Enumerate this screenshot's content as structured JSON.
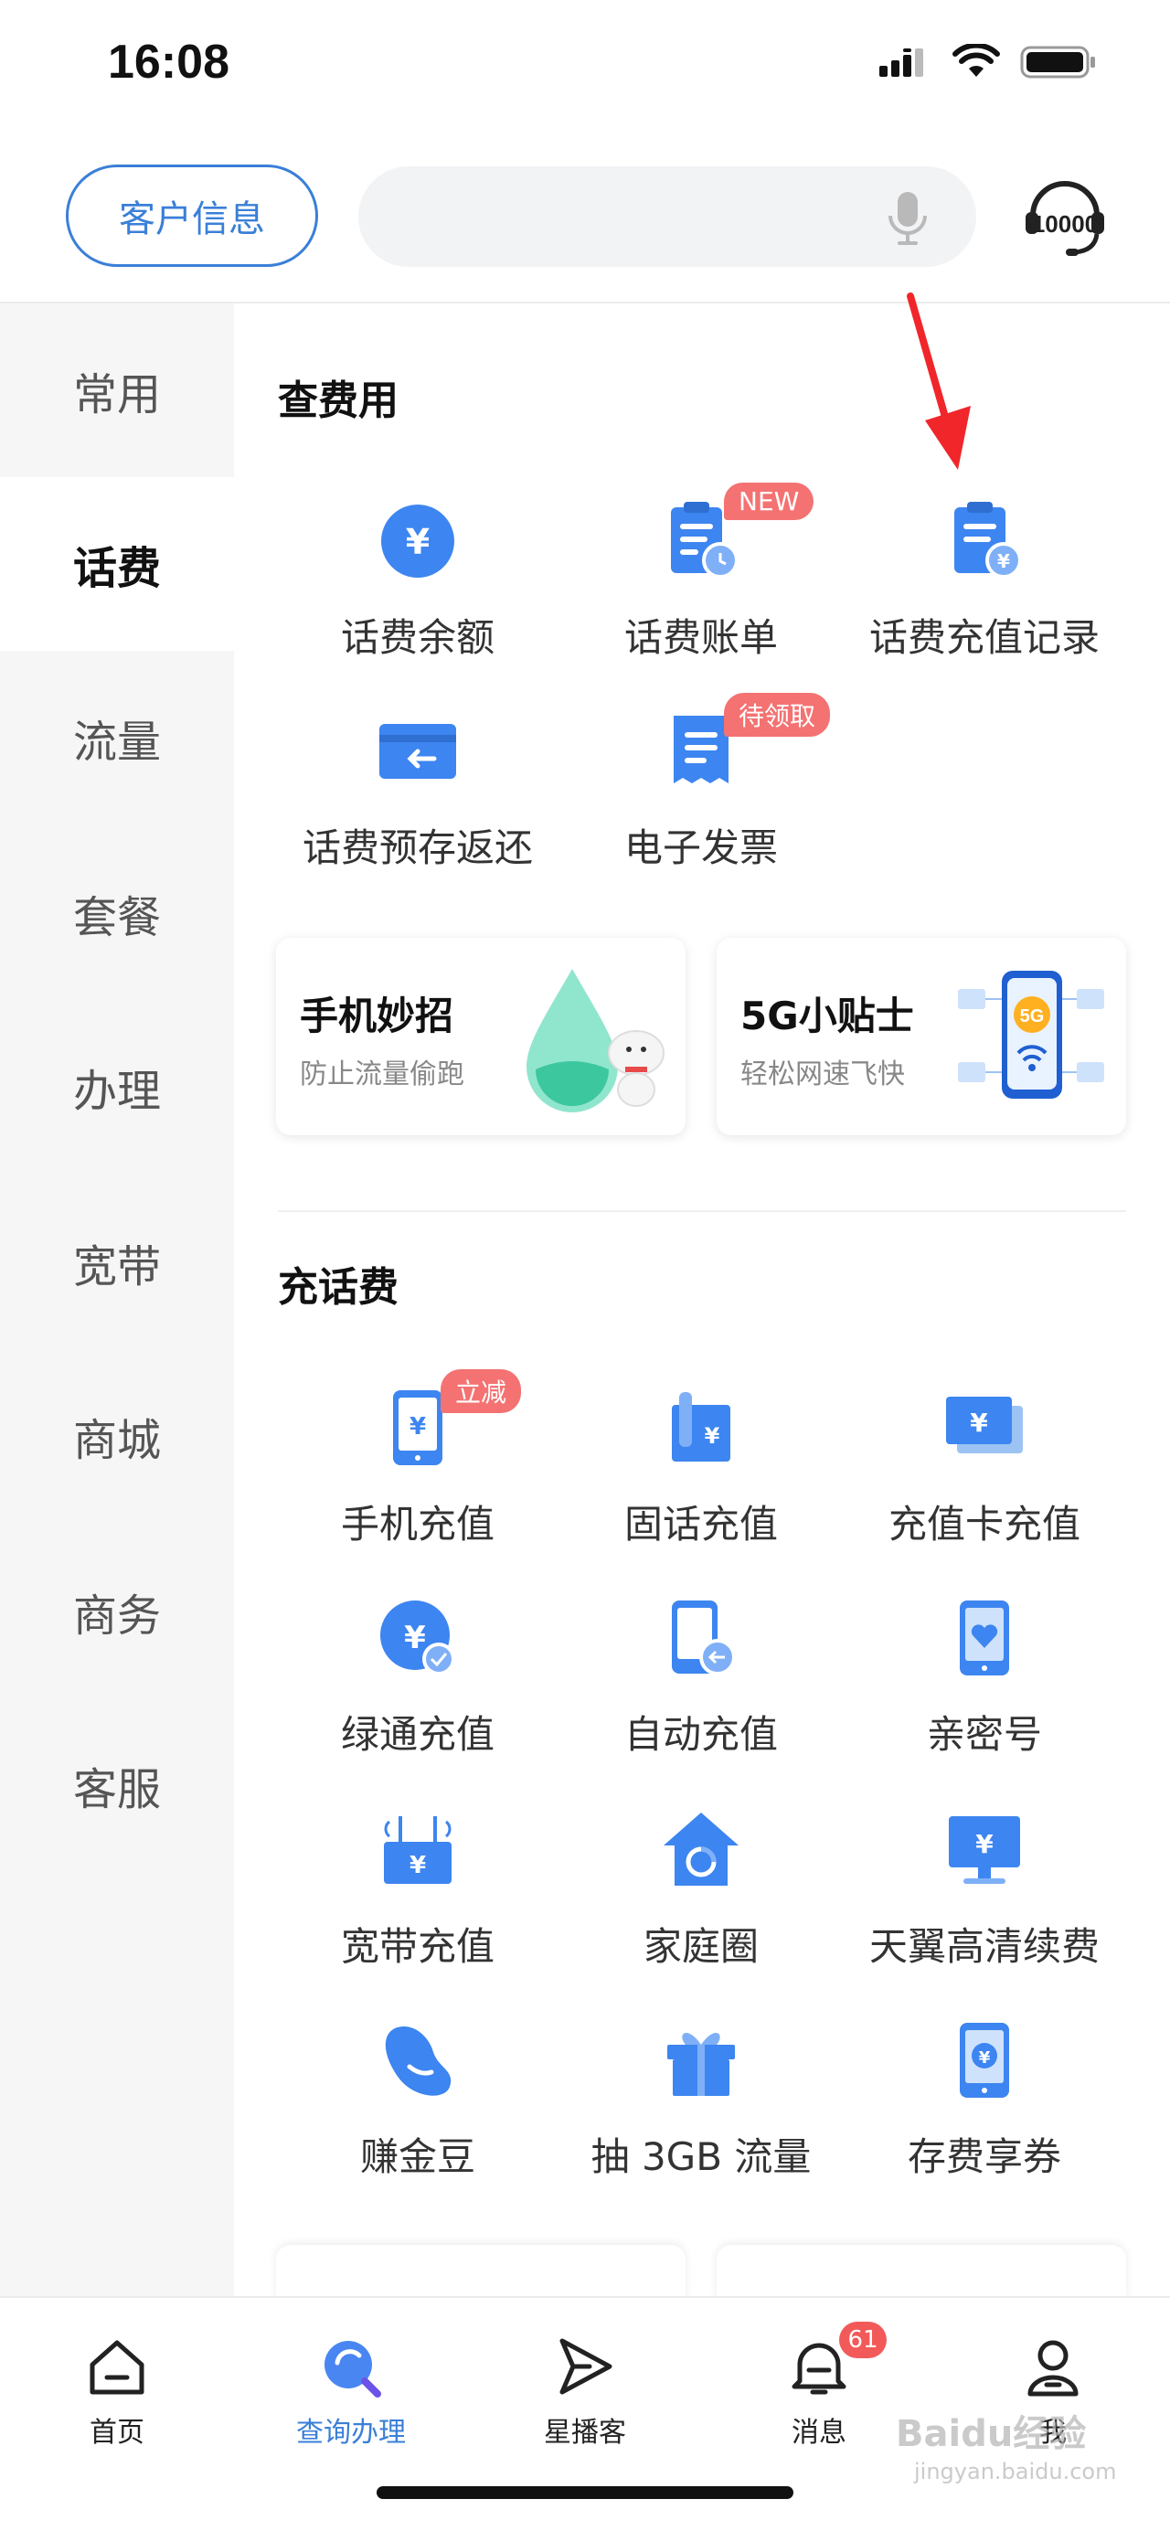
{
  "status_bar": {
    "time": "16:08"
  },
  "header": {
    "customer_info_label": "客户信息",
    "service_icon_text": "10000"
  },
  "sidebar": {
    "items": [
      {
        "label": "常用"
      },
      {
        "label": "话费"
      },
      {
        "label": "流量"
      },
      {
        "label": "套餐"
      },
      {
        "label": "办理"
      },
      {
        "label": "宽带"
      },
      {
        "label": "商城"
      },
      {
        "label": "商务"
      },
      {
        "label": "客服"
      }
    ],
    "active_index": 1
  },
  "sections": {
    "check_fees": {
      "title": "查费用",
      "items": [
        {
          "label": "话费余额",
          "icon": "yuan-coin-icon"
        },
        {
          "label": "话费账单",
          "icon": "bill-clock-icon",
          "badge": "NEW"
        },
        {
          "label": "话费充值记录",
          "icon": "recharge-record-icon"
        },
        {
          "label": "话费预存返还",
          "icon": "card-return-icon"
        },
        {
          "label": "电子发票",
          "icon": "invoice-icon",
          "badge": "待领取"
        }
      ]
    },
    "promos": [
      {
        "title": "手机妙招",
        "subtitle": "防止流量偷跑",
        "art": "water-drop-mascot"
      },
      {
        "title": "5G小贴士",
        "subtitle": "轻松网速飞快",
        "art": "5g-phone",
        "art_text": "5G"
      }
    ],
    "recharge": {
      "title": "充话费",
      "items": [
        {
          "label": "手机充值",
          "icon": "phone-yuan-icon",
          "badge": "立减"
        },
        {
          "label": "固话充值",
          "icon": "landline-icon"
        },
        {
          "label": "充值卡充值",
          "icon": "recharge-card-icon"
        },
        {
          "label": "绿通充值",
          "icon": "green-channel-icon"
        },
        {
          "label": "自动充值",
          "icon": "auto-recharge-icon"
        },
        {
          "label": "亲密号",
          "icon": "heart-phone-icon"
        },
        {
          "label": "宽带充值",
          "icon": "router-icon"
        },
        {
          "label": "家庭圈",
          "icon": "home-circle-icon"
        },
        {
          "label": "天翼高清续费",
          "icon": "tv-yuan-icon"
        },
        {
          "label": "赚金豆",
          "icon": "bean-icon"
        },
        {
          "label": "抽 3GB 流量",
          "icon": "gift-icon"
        },
        {
          "label": "存费享券",
          "icon": "phone-coupon-icon"
        }
      ]
    }
  },
  "tabbar": {
    "items": [
      {
        "label": "首页",
        "icon": "home-icon"
      },
      {
        "label": "查询办理",
        "icon": "search-service-icon"
      },
      {
        "label": "星播客",
        "icon": "play-triangle-icon"
      },
      {
        "label": "消息",
        "icon": "bell-icon",
        "badge": "61"
      },
      {
        "label": "我",
        "icon": "person-icon"
      }
    ],
    "active_index": 1
  },
  "watermark": {
    "brand": "Baidu经验",
    "url": "jingyan.baidu.com"
  },
  "colors": {
    "accent": "#3a7fd8",
    "icon_blue": "#3d85f0",
    "badge_red": "#f47272",
    "arrow_red": "#f0262a"
  }
}
